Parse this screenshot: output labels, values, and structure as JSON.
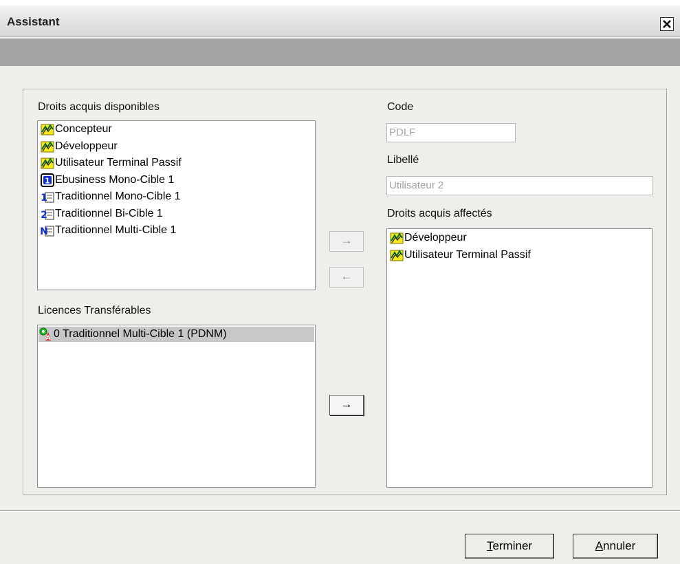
{
  "window": {
    "title": "Assistant",
    "close_glyph": "✕"
  },
  "labels": {
    "available_rights": "Droits acquis disponibles",
    "transferable_licences": "Licences Transférables",
    "code": "Code",
    "libelle": "Libellé",
    "assigned_rights": "Droits acquis affectés"
  },
  "fields": {
    "code_value": "PDLF",
    "libelle_value": "Utilisateur 2"
  },
  "available_rights": [
    {
      "label": "Concepteur",
      "icon": "role-icon"
    },
    {
      "label": "Développeur",
      "icon": "role-icon"
    },
    {
      "label": "Utilisateur Terminal Passif",
      "icon": "role-icon"
    },
    {
      "label": "Ebusiness Mono-Cible 1",
      "icon": "licence-1-icon"
    },
    {
      "label": "Traditionnel Mono-Cible 1",
      "icon": "licence-1-doc-icon"
    },
    {
      "label": "Traditionnel Bi-Cible 1",
      "icon": "licence-2-doc-icon"
    },
    {
      "label": "Traditionnel Multi-Cible 1",
      "icon": "licence-n-doc-icon"
    }
  ],
  "transferable_licences": [
    {
      "label": "0 Traditionnel Multi-Cible 1 (PDNM)",
      "icon": "transfer-licence-icon",
      "selected": true
    }
  ],
  "assigned_rights": [
    {
      "label": "Développeur",
      "icon": "role-icon"
    },
    {
      "label": "Utilisateur Terminal Passif",
      "icon": "role-icon"
    }
  ],
  "arrows": {
    "add": "→",
    "remove": "←",
    "transfer": "→"
  },
  "buttons": {
    "finish_mnemonic": "T",
    "finish_rest": "erminer",
    "cancel_mnemonic": "A",
    "cancel_rest": "nnuler"
  },
  "colors": {
    "dialog_bg": "#efeeea",
    "stripe": "#a3a3a3",
    "disabled_text": "#a3a3a3",
    "selection": "#c7c7c7"
  }
}
